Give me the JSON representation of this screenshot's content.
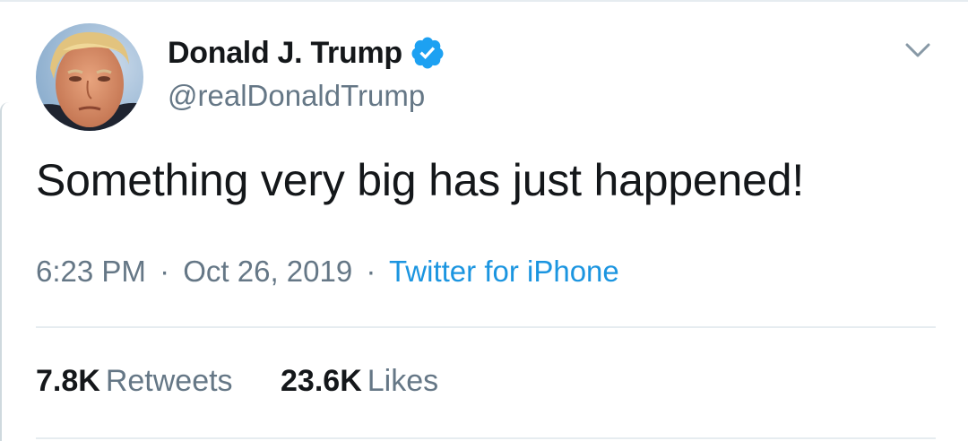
{
  "tweet": {
    "author": {
      "display_name": "Donald J. Trump",
      "handle": "@realDonaldTrump",
      "verified": true,
      "avatar_icon": "profile-photo"
    },
    "text": "Something very big has just happened!",
    "meta": {
      "time": "6:23 PM",
      "separator": "·",
      "date": "Oct 26, 2019",
      "source": "Twitter for iPhone"
    },
    "stats": {
      "retweets_count": "7.8K",
      "retweets_label": "Retweets",
      "likes_count": "23.6K",
      "likes_label": "Likes"
    },
    "menu_icon": "chevron-down-icon"
  },
  "colors": {
    "text_primary": "#14171a",
    "text_secondary": "#657786",
    "link": "#1b95e0",
    "verified": "#1da1f2",
    "divider": "#e6ecf0"
  }
}
